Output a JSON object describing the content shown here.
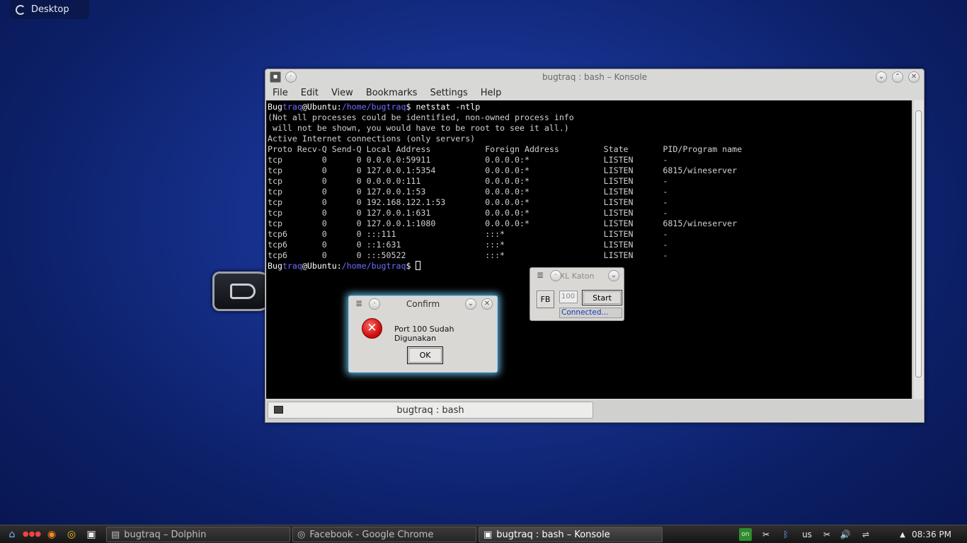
{
  "desktop": {
    "toolbox_label": "Desktop"
  },
  "konsole": {
    "title": "bugtraq : bash – Konsole",
    "menu": [
      "File",
      "Edit",
      "View",
      "Bookmarks",
      "Settings",
      "Help"
    ],
    "prompt_user": "Bug",
    "prompt_user2": "traq",
    "prompt_host": "@Ubuntu:",
    "prompt_path": "/home/bugtraq",
    "prompt_end": "$ ",
    "command": "netstat -ntlp",
    "output_lines": [
      "(Not all processes could be identified, non-owned process info",
      " will not be shown, you would have to be root to see it all.)",
      "Active Internet connections (only servers)",
      "Proto Recv-Q Send-Q Local Address           Foreign Address         State       PID/Program name",
      "tcp        0      0 0.0.0.0:59911           0.0.0.0:*               LISTEN      -",
      "tcp        0      0 127.0.0.1:5354          0.0.0.0:*               LISTEN      6815/wineserver",
      "tcp        0      0 0.0.0.0:111             0.0.0.0:*               LISTEN      -",
      "tcp        0      0 127.0.0.1:53            0.0.0.0:*               LISTEN      -",
      "tcp        0      0 192.168.122.1:53        0.0.0.0:*               LISTEN      -",
      "tcp        0      0 127.0.0.1:631           0.0.0.0:*               LISTEN      -",
      "tcp        0      0 127.0.0.1:1080          0.0.0.0:*               LISTEN      6815/wineserver",
      "tcp6       0      0 :::111                  :::*                    LISTEN      -",
      "tcp6       0      0 ::1:631                 :::*                    LISTEN      -",
      "tcp6       0      0 :::50522                :::*                    LISTEN      -"
    ],
    "tab_label": "bugtraq : bash"
  },
  "confirm": {
    "title": "Confirm",
    "message": "Port 100 Sudah Digunakan",
    "ok_label": "OK"
  },
  "xlkaton": {
    "title": "XL Katon",
    "fb_label": "FB",
    "port_value": "100",
    "start_label": "Start",
    "status": "Connected..."
  },
  "taskbar": {
    "tasks": [
      "bugtraq – Dolphin",
      "Facebook - Google Chrome",
      "bugtraq : bash – Konsole"
    ],
    "keyboard_layout": "us",
    "network_label": "on",
    "clock": "08:36 PM"
  }
}
